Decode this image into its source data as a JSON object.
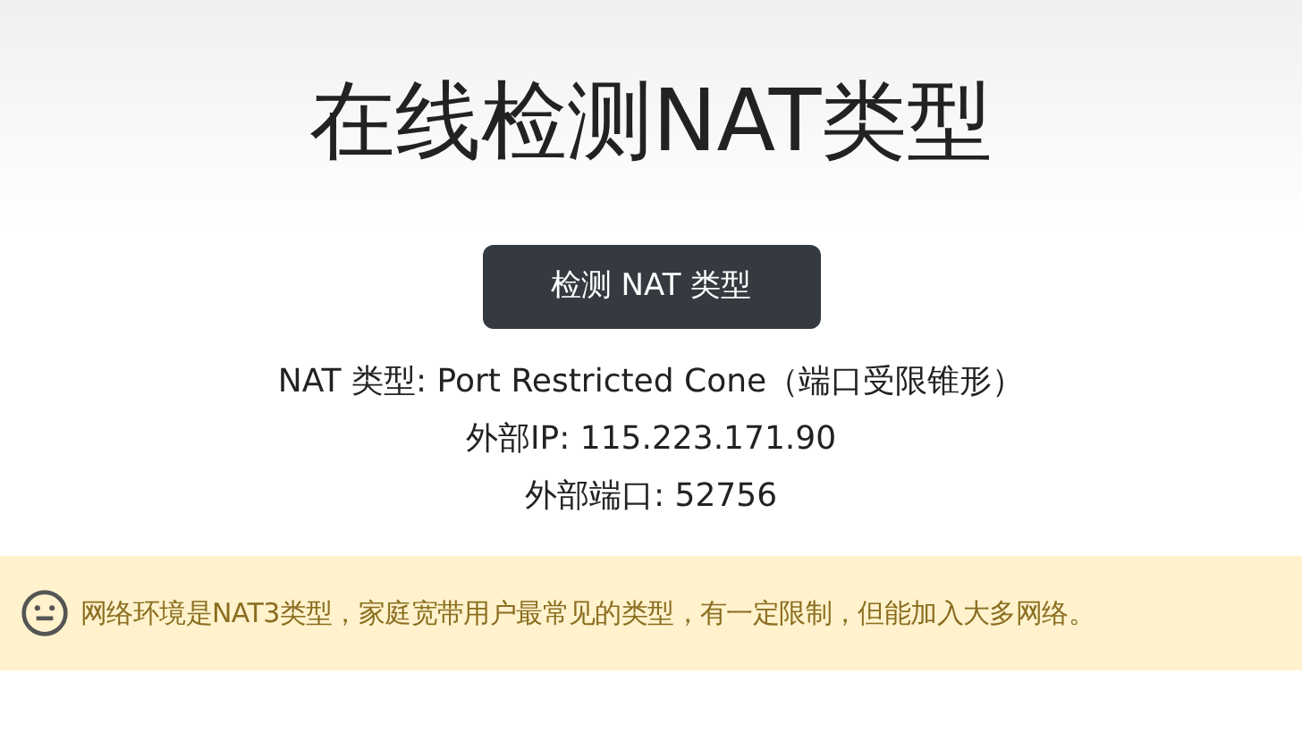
{
  "title": "在线检测NAT类型",
  "button": "检测 NAT 类型",
  "results": [
    "NAT 类型: Port Restricted Cone（端口受限锥形）",
    "外部IP: 115.223.171.90",
    "外部端口: 52756"
  ],
  "alert": {
    "kind": "neutral",
    "text": "网络环境是NAT3类型，家庭宽带用户最常见的类型，有一定限制，但能加入大多网络。"
  }
}
